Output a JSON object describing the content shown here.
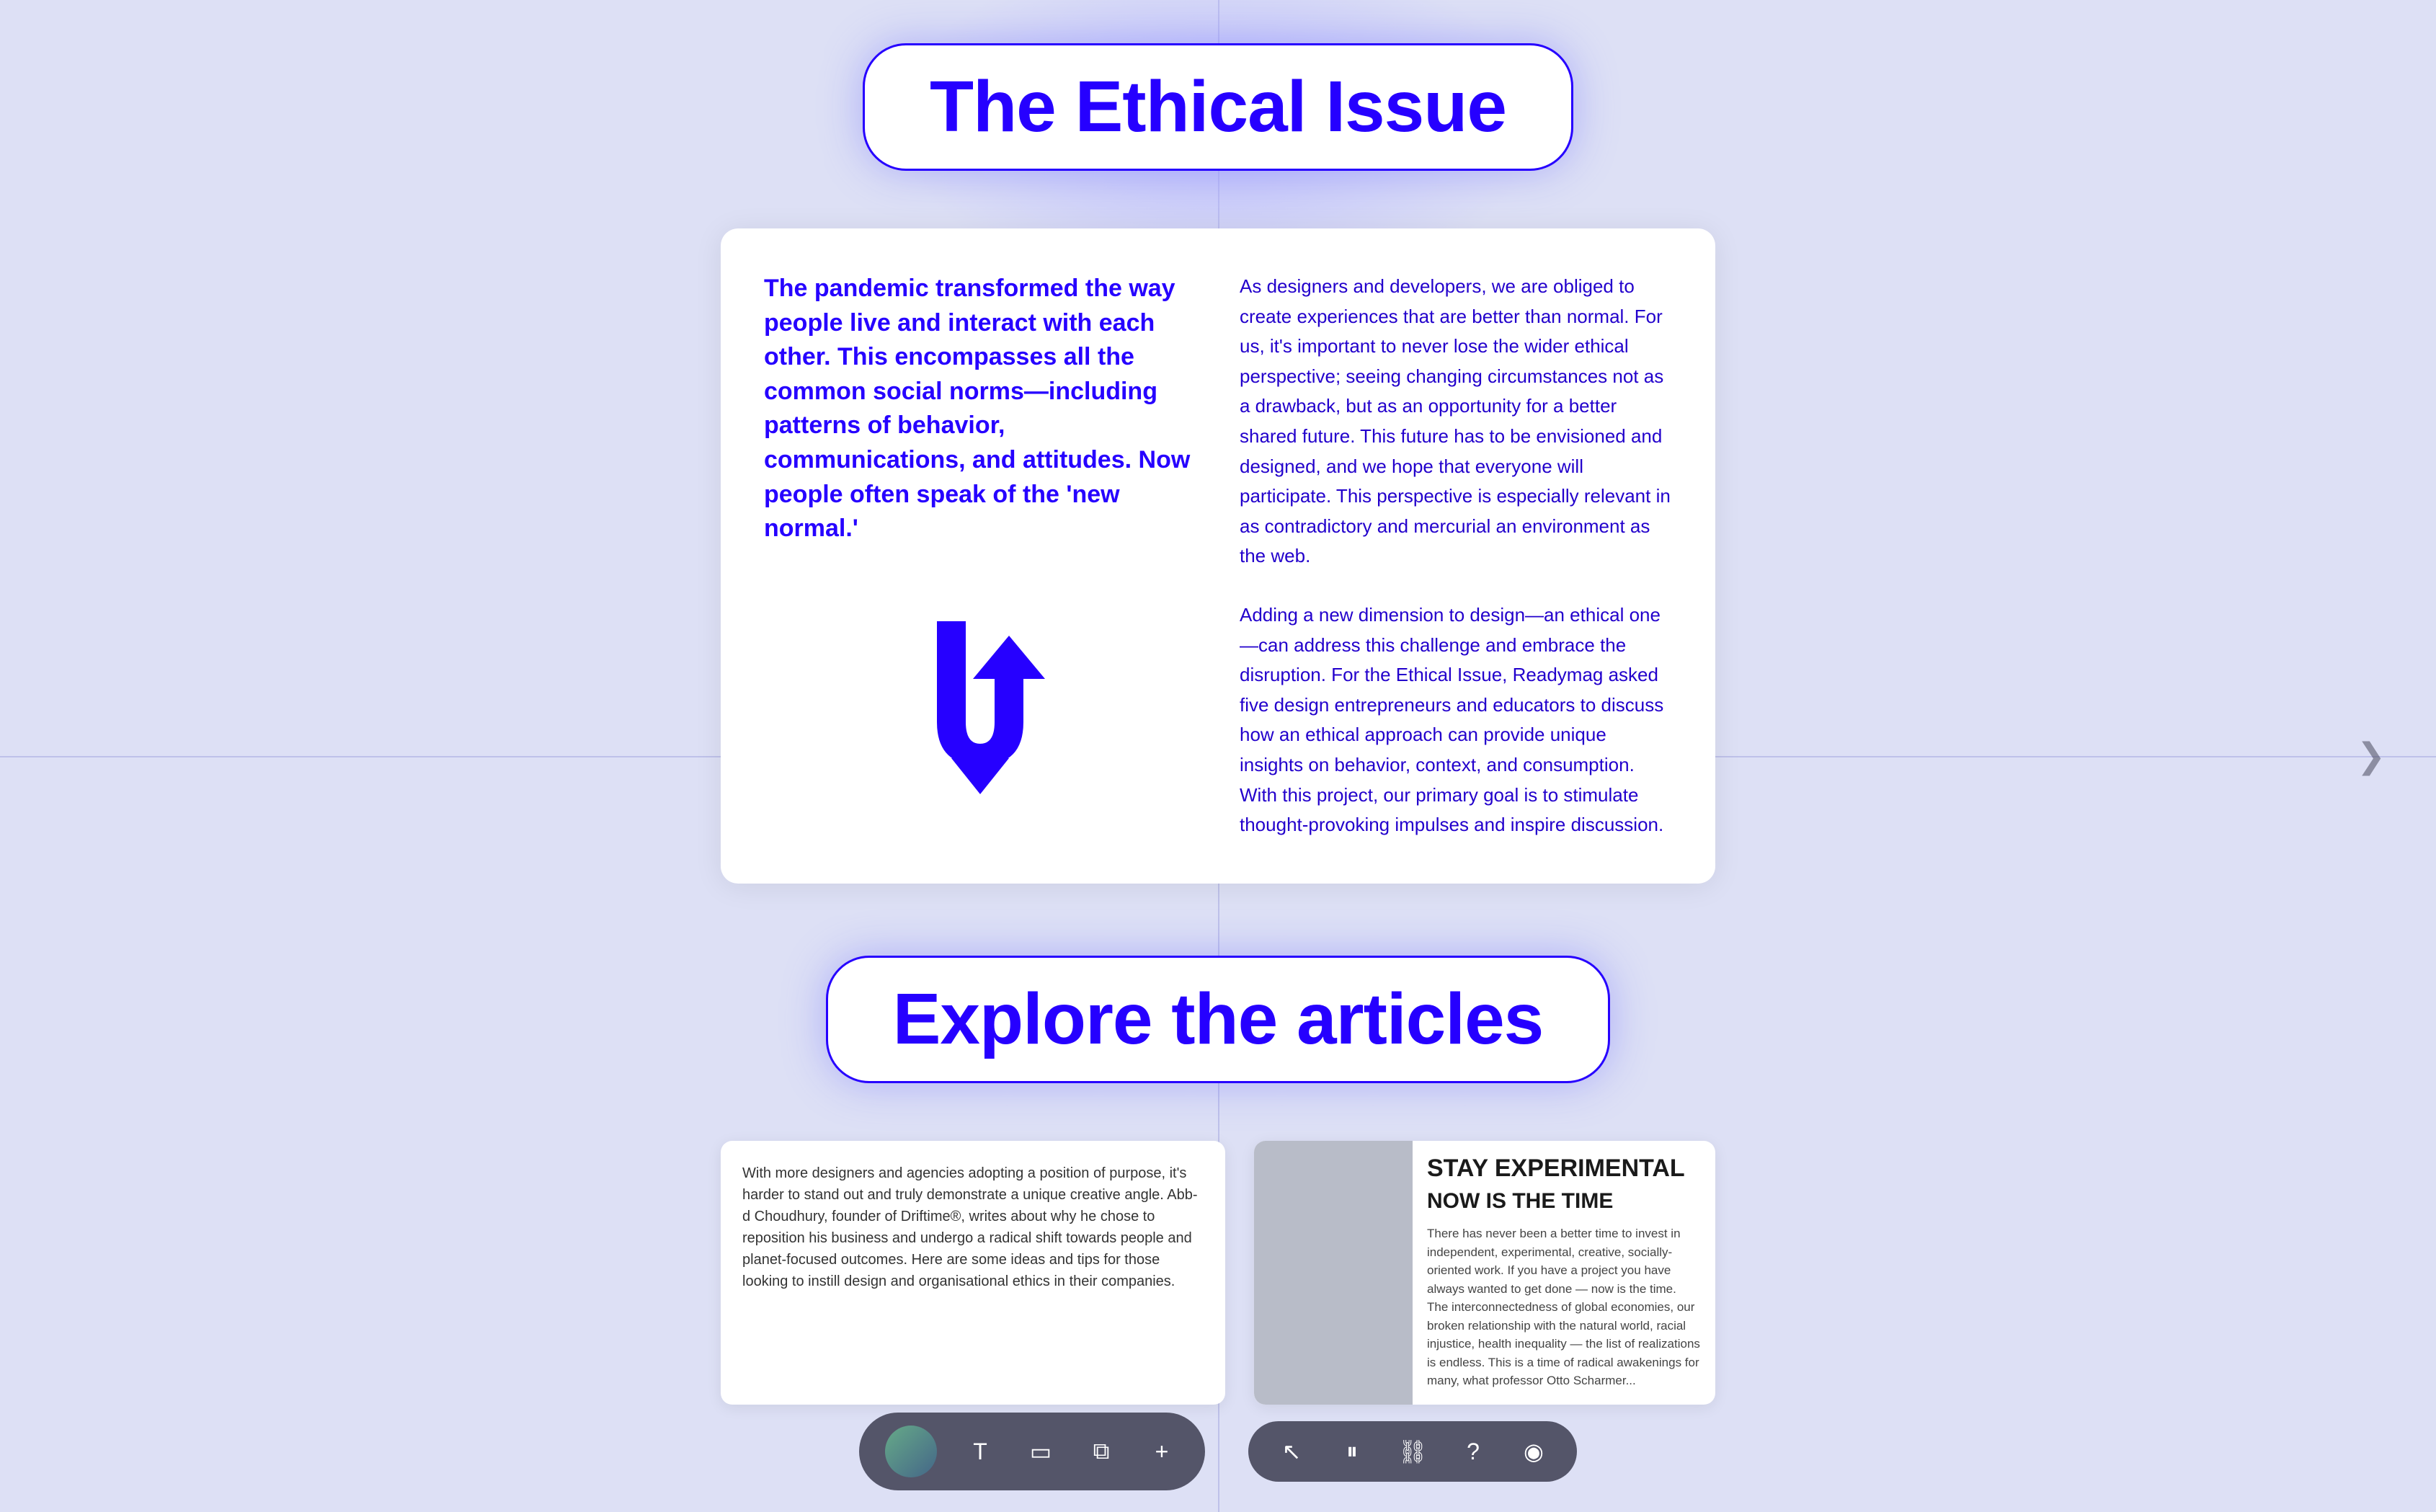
{
  "page": {
    "background_color": "#dde0f5"
  },
  "title": {
    "label": "The Ethical Issue"
  },
  "intro_card": {
    "left_text": "The pandemic transformed the way people live and interact with each other. This encompasses all the common social norms—including patterns of behavior, communications, and attitudes. Now people often speak of the 'new normal.'",
    "right_para1": "As designers and developers, we are obliged to create experiences that are better than normal. For us, it's important to never lose the wider ethical perspective; seeing changing circumstances not as a drawback, but as an opportunity for a better shared future. This future has to be envisioned and designed, and we hope that everyone will participate. This perspective is especially relevant in as contradictory and mercurial an environment as the web.",
    "right_para2": "Adding a new dimension to design—an ethical one—can address this challenge and embrace the disruption. For the Ethical Issue, Readymag asked five design entrepreneurs and educators to discuss how an ethical approach can provide unique insights on behavior, context, and consumption. With this project, our primary goal is to stimulate thought-provoking impulses and inspire discussion."
  },
  "explore": {
    "label": "Explore the articles"
  },
  "articles": [
    {
      "type": "text",
      "content": "With more designers and agencies adopting a position of purpose, it's harder to stand out and truly demonstrate a unique creative angle. Abb-d Choudhury, founder of Driftime®, writes about why he chose to reposition his business and undergo a radical shift towards people and planet-focused outcomes. Here are some ideas and tips for those looking to instill design and organisational ethics in their companies."
    },
    {
      "type": "visual",
      "heading1": "STAY EXPERIMENTAL",
      "heading2": "NOW IS THE TIME",
      "para1": "There has never been a better time to invest in independent, experimental, creative, socially-oriented work. If you have a project you have always wanted to get done — now is the time.",
      "para2": "The interconnectedness of global economies, our broken relationship with the natural world, racial injustice, health inequality — the list of realizations is endless. This is a time of radical awakenings for many, what professor Otto Scharmer..."
    }
  ],
  "toolbar_left": {
    "icons": [
      {
        "name": "text-icon",
        "symbol": "T"
      },
      {
        "name": "frame-icon",
        "symbol": "▭"
      },
      {
        "name": "layers-icon",
        "symbol": "⧉"
      },
      {
        "name": "add-icon",
        "symbol": "+"
      }
    ]
  },
  "toolbar_right": {
    "icons": [
      {
        "name": "cursor-icon",
        "symbol": "↖"
      },
      {
        "name": "pause-icon",
        "symbol": "⏸"
      },
      {
        "name": "link-icon",
        "symbol": "⛓"
      },
      {
        "name": "help-icon",
        "symbol": "?"
      },
      {
        "name": "eye-icon",
        "symbol": "◉"
      }
    ]
  },
  "nav": {
    "arrow_right": "❯"
  }
}
